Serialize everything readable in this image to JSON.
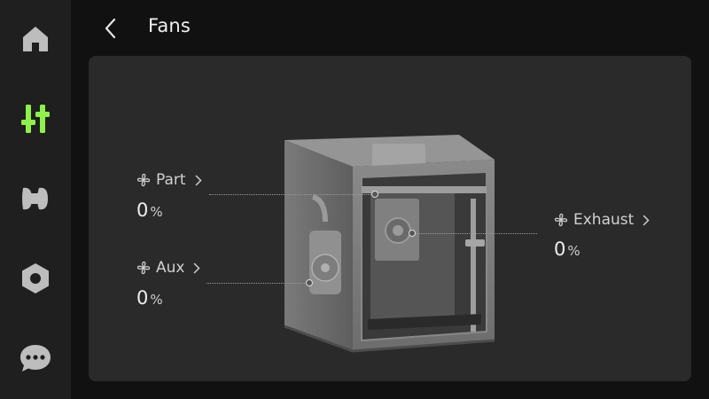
{
  "header": {
    "title": "Fans"
  },
  "sidebar": {
    "items": [
      {
        "name": "home",
        "icon": "home-icon"
      },
      {
        "name": "controls",
        "icon": "sliders-icon",
        "active": true
      },
      {
        "name": "filament",
        "icon": "filament-spool-icon"
      },
      {
        "name": "settings",
        "icon": "hex-nut-icon"
      },
      {
        "name": "messages",
        "icon": "chat-bubble-icon"
      }
    ]
  },
  "colors": {
    "accent": "#8ef04a",
    "icon": "#bdbdbd",
    "panel": "#2a2a2a",
    "sidebar": "#1f1f1f",
    "background": "#111111"
  },
  "fans": {
    "part": {
      "label": "Part",
      "value": "0",
      "unit": "%"
    },
    "aux": {
      "label": "Aux",
      "value": "0",
      "unit": "%"
    },
    "exhaust": {
      "label": "Exhaust",
      "value": "0",
      "unit": "%"
    }
  }
}
